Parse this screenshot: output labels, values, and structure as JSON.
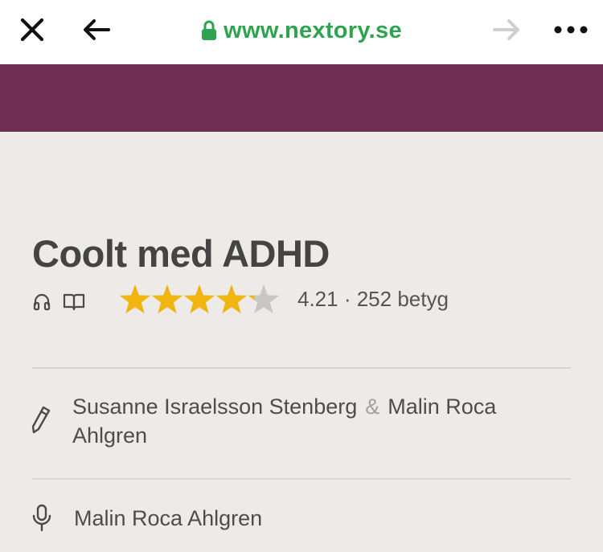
{
  "browser": {
    "url": "www.nextory.se",
    "close_icon": "close-icon",
    "back_icon": "arrow-left-icon",
    "forward_icon": "arrow-right-icon",
    "more_icon": "more-horizontal-icon",
    "lock_icon": "lock-icon"
  },
  "colors": {
    "banner": "#6e2f52",
    "url_green": "#2ea44f",
    "star_filled": "#f2b40f",
    "star_empty": "#c9c6c3",
    "background": "#edeae7"
  },
  "book": {
    "title": "Coolt med ADHD",
    "formats": [
      "headphones-icon",
      "book-open-icon"
    ],
    "rating": {
      "value": 4.21,
      "max": 5,
      "text": "4.21 · 252 betyg"
    },
    "authors": {
      "first": "Susanne Israelsson Stenberg",
      "separator": "&",
      "second": "Malin Roca Ahlgren"
    },
    "narrator": "Malin Roca Ahlgren"
  }
}
